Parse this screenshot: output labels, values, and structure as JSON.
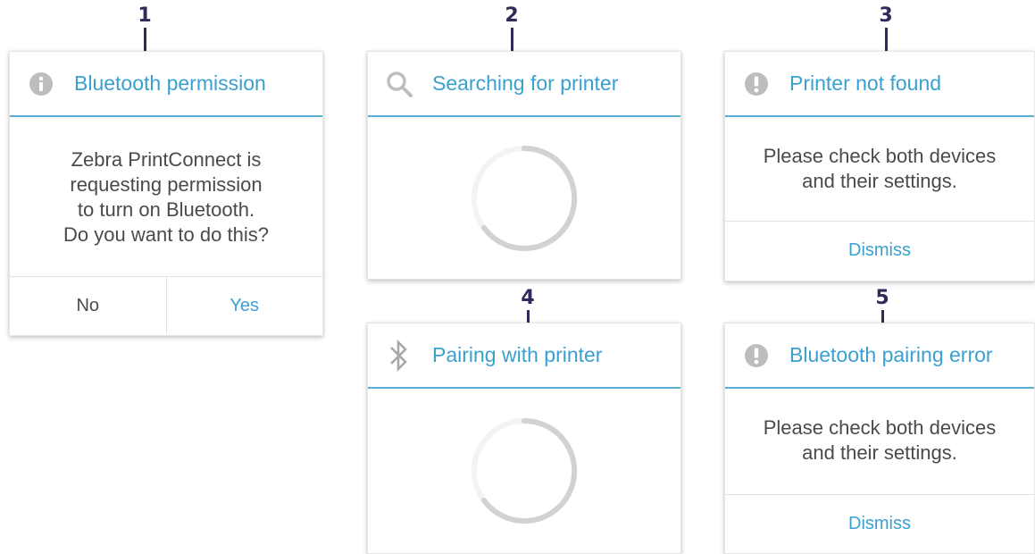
{
  "callouts": [
    "1",
    "2",
    "3",
    "4",
    "5"
  ],
  "dialogs": {
    "permission": {
      "icon": "info-icon",
      "title": "Bluetooth permission",
      "message": [
        "Zebra PrintConnect is",
        "requesting permission",
        "to turn on Bluetooth.",
        "Do you want to do this?"
      ],
      "no_label": "No",
      "yes_label": "Yes"
    },
    "searching": {
      "icon": "search-icon",
      "title": "Searching for printer"
    },
    "not_found": {
      "icon": "alert-icon",
      "title": "Printer not found",
      "message": [
        "Please check both devices",
        "and their settings."
      ],
      "dismiss_label": "Dismiss"
    },
    "pairing": {
      "icon": "bluetooth-icon",
      "title": "Pairing with printer"
    },
    "pairing_error": {
      "icon": "alert-icon",
      "title": "Bluetooth pairing error",
      "message": [
        "Please check both devices",
        "and their settings."
      ],
      "dismiss_label": "Dismiss"
    }
  },
  "colors": {
    "accent": "#3aa0cf",
    "divider": "#59aed6",
    "callout": "#2e2a5a",
    "icon_gray": "#bdbdbd",
    "text": "#4a4a4a"
  }
}
